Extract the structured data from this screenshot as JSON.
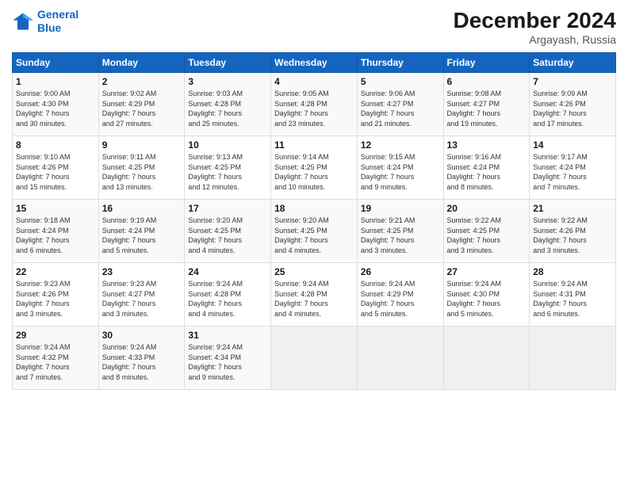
{
  "header": {
    "logo_line1": "General",
    "logo_line2": "Blue",
    "month": "December 2024",
    "location": "Argayash, Russia"
  },
  "columns": [
    "Sunday",
    "Monday",
    "Tuesday",
    "Wednesday",
    "Thursday",
    "Friday",
    "Saturday"
  ],
  "weeks": [
    [
      {
        "day": "1",
        "info": "Sunrise: 9:00 AM\nSunset: 4:30 PM\nDaylight: 7 hours\nand 30 minutes."
      },
      {
        "day": "2",
        "info": "Sunrise: 9:02 AM\nSunset: 4:29 PM\nDaylight: 7 hours\nand 27 minutes."
      },
      {
        "day": "3",
        "info": "Sunrise: 9:03 AM\nSunset: 4:28 PM\nDaylight: 7 hours\nand 25 minutes."
      },
      {
        "day": "4",
        "info": "Sunrise: 9:05 AM\nSunset: 4:28 PM\nDaylight: 7 hours\nand 23 minutes."
      },
      {
        "day": "5",
        "info": "Sunrise: 9:06 AM\nSunset: 4:27 PM\nDaylight: 7 hours\nand 21 minutes."
      },
      {
        "day": "6",
        "info": "Sunrise: 9:08 AM\nSunset: 4:27 PM\nDaylight: 7 hours\nand 19 minutes."
      },
      {
        "day": "7",
        "info": "Sunrise: 9:09 AM\nSunset: 4:26 PM\nDaylight: 7 hours\nand 17 minutes."
      }
    ],
    [
      {
        "day": "8",
        "info": "Sunrise: 9:10 AM\nSunset: 4:26 PM\nDaylight: 7 hours\nand 15 minutes."
      },
      {
        "day": "9",
        "info": "Sunrise: 9:11 AM\nSunset: 4:25 PM\nDaylight: 7 hours\nand 13 minutes."
      },
      {
        "day": "10",
        "info": "Sunrise: 9:13 AM\nSunset: 4:25 PM\nDaylight: 7 hours\nand 12 minutes."
      },
      {
        "day": "11",
        "info": "Sunrise: 9:14 AM\nSunset: 4:25 PM\nDaylight: 7 hours\nand 10 minutes."
      },
      {
        "day": "12",
        "info": "Sunrise: 9:15 AM\nSunset: 4:24 PM\nDaylight: 7 hours\nand 9 minutes."
      },
      {
        "day": "13",
        "info": "Sunrise: 9:16 AM\nSunset: 4:24 PM\nDaylight: 7 hours\nand 8 minutes."
      },
      {
        "day": "14",
        "info": "Sunrise: 9:17 AM\nSunset: 4:24 PM\nDaylight: 7 hours\nand 7 minutes."
      }
    ],
    [
      {
        "day": "15",
        "info": "Sunrise: 9:18 AM\nSunset: 4:24 PM\nDaylight: 7 hours\nand 6 minutes."
      },
      {
        "day": "16",
        "info": "Sunrise: 9:19 AM\nSunset: 4:24 PM\nDaylight: 7 hours\nand 5 minutes."
      },
      {
        "day": "17",
        "info": "Sunrise: 9:20 AM\nSunset: 4:25 PM\nDaylight: 7 hours\nand 4 minutes."
      },
      {
        "day": "18",
        "info": "Sunrise: 9:20 AM\nSunset: 4:25 PM\nDaylight: 7 hours\nand 4 minutes."
      },
      {
        "day": "19",
        "info": "Sunrise: 9:21 AM\nSunset: 4:25 PM\nDaylight: 7 hours\nand 3 minutes."
      },
      {
        "day": "20",
        "info": "Sunrise: 9:22 AM\nSunset: 4:25 PM\nDaylight: 7 hours\nand 3 minutes."
      },
      {
        "day": "21",
        "info": "Sunrise: 9:22 AM\nSunset: 4:26 PM\nDaylight: 7 hours\nand 3 minutes."
      }
    ],
    [
      {
        "day": "22",
        "info": "Sunrise: 9:23 AM\nSunset: 4:26 PM\nDaylight: 7 hours\nand 3 minutes."
      },
      {
        "day": "23",
        "info": "Sunrise: 9:23 AM\nSunset: 4:27 PM\nDaylight: 7 hours\nand 3 minutes."
      },
      {
        "day": "24",
        "info": "Sunrise: 9:24 AM\nSunset: 4:28 PM\nDaylight: 7 hours\nand 4 minutes."
      },
      {
        "day": "25",
        "info": "Sunrise: 9:24 AM\nSunset: 4:28 PM\nDaylight: 7 hours\nand 4 minutes."
      },
      {
        "day": "26",
        "info": "Sunrise: 9:24 AM\nSunset: 4:29 PM\nDaylight: 7 hours\nand 5 minutes."
      },
      {
        "day": "27",
        "info": "Sunrise: 9:24 AM\nSunset: 4:30 PM\nDaylight: 7 hours\nand 5 minutes."
      },
      {
        "day": "28",
        "info": "Sunrise: 9:24 AM\nSunset: 4:31 PM\nDaylight: 7 hours\nand 6 minutes."
      }
    ],
    [
      {
        "day": "29",
        "info": "Sunrise: 9:24 AM\nSunset: 4:32 PM\nDaylight: 7 hours\nand 7 minutes."
      },
      {
        "day": "30",
        "info": "Sunrise: 9:24 AM\nSunset: 4:33 PM\nDaylight: 7 hours\nand 8 minutes."
      },
      {
        "day": "31",
        "info": "Sunrise: 9:24 AM\nSunset: 4:34 PM\nDaylight: 7 hours\nand 9 minutes."
      },
      null,
      null,
      null,
      null
    ]
  ]
}
